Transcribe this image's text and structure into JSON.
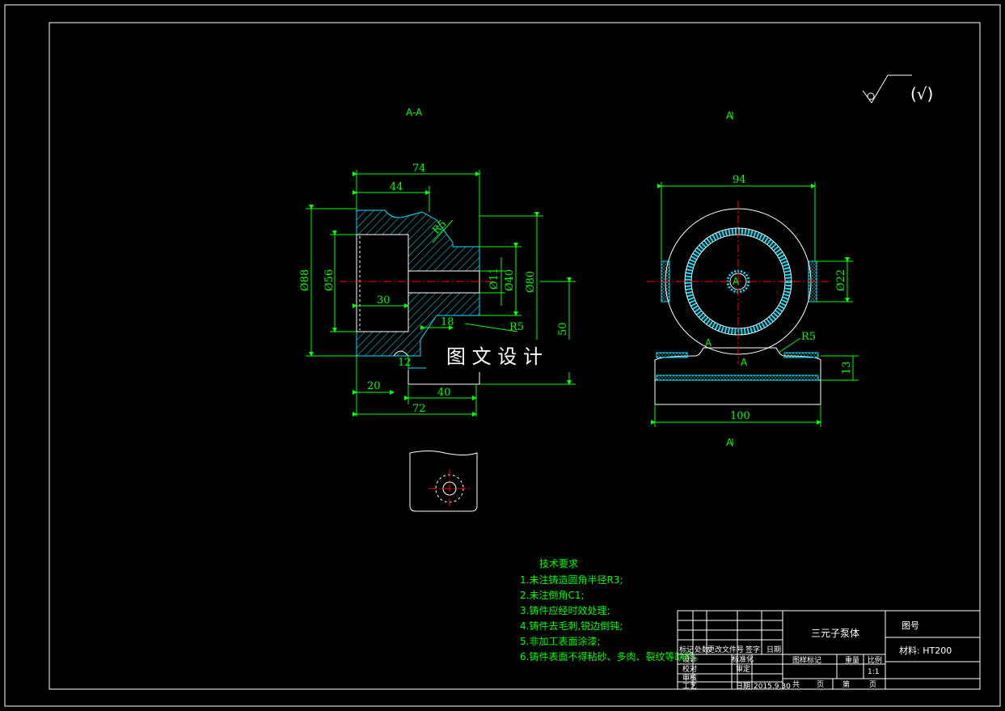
{
  "section_label": "A-A",
  "view_arrow_label": "A",
  "roughness": {
    "symbol": "(√)"
  },
  "watermark": "图 文 设 计",
  "section_view": {
    "dims": {
      "d74": "74",
      "d44": "44",
      "r5_top": "R5",
      "d88": "Ø88",
      "d56": "Ø56",
      "d30": "30",
      "d11": "Ø11",
      "d40": "Ø40",
      "d80": "Ø80",
      "d18": "18",
      "r5_bottom": "R5",
      "d50": "50",
      "d12": "12",
      "d20": "20",
      "d40b": "40",
      "d72": "72"
    }
  },
  "front_view": {
    "dims": {
      "d94": "94",
      "d22": "Ø22",
      "r5": "R5",
      "d13": "13",
      "d100": "100"
    },
    "section_marks": {
      "left": "A",
      "center": "A",
      "hole": "A"
    }
  },
  "tech_requirements": {
    "title": "技术要求",
    "items": [
      "1.未注铸造圆角半径R3;",
      "2.未注倒角C1;",
      "3.铸件应经时效处理;",
      "4.铸件去毛刺,锐边倒钝;",
      "5.非加工表面涂漆;",
      "6.铸件表面不得粘砂、多肉、裂纹等缺陷。"
    ]
  },
  "title_block": {
    "part_name": "三元子泵体",
    "drawing_no_label": "图号",
    "material": "材料: HT200",
    "row_headers": [
      "标记",
      "处数",
      "更改文件号",
      "签字",
      "日期"
    ],
    "design_label": "设计",
    "std_label": "标准化",
    "check_label": "校对",
    "review_label": "审核",
    "approve_label": "审定",
    "process_label": "工艺",
    "date_label": "日期",
    "date_value": "2015.9.30",
    "stage_label": "图样标记",
    "weight_label": "重量",
    "scale_label": "比例",
    "scale_value": "1:1",
    "total_label": "共",
    "page_label": "页",
    "sheet_label": "第",
    "sheet_page_label": "页"
  }
}
